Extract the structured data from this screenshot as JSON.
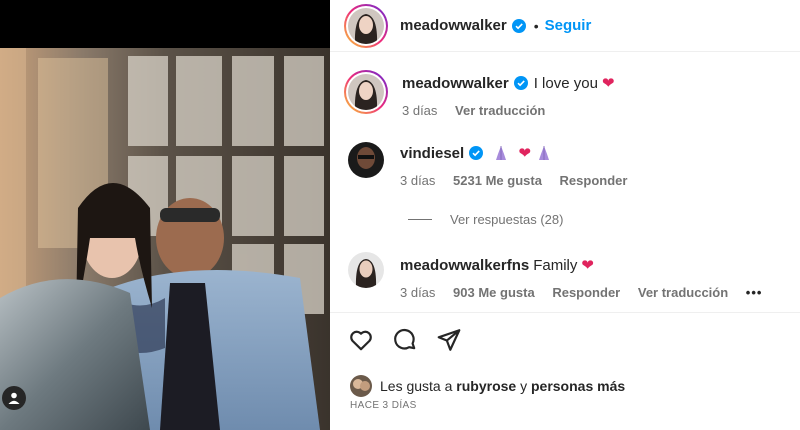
{
  "post": {
    "username": "meadowwalker",
    "follow_label": "Seguir",
    "dot": "•"
  },
  "comments": [
    {
      "username": "meadowwalker",
      "text": "I love you",
      "emoji": "❤",
      "time": "3 días",
      "translate": "Ver traducción"
    },
    {
      "username": "vindiesel",
      "emoji": "❤",
      "time": "3 días",
      "likes": "5231 Me gusta",
      "reply": "Responder",
      "view_replies": "Ver respuestas (28)"
    },
    {
      "username": "meadowwalkerfns",
      "text": "Family",
      "emoji": "❤",
      "time": "3 días",
      "likes": "903 Me gusta",
      "reply": "Responder",
      "translate": "Ver traducción",
      "more": "•••"
    }
  ],
  "likes_summary": {
    "prefix": "Les gusta a",
    "user": "rubyrose",
    "joiner": "y",
    "others": "personas más"
  },
  "timestamp": "HACE 3 DÍAS",
  "colors": {
    "link": "#0095f6",
    "verified": "#0095f6",
    "heart": "#e0245e",
    "muted": "#737373"
  },
  "icons": [
    "heart-icon",
    "comment-icon",
    "share-icon",
    "verified-icon",
    "user-tag-icon",
    "more-icon"
  ]
}
